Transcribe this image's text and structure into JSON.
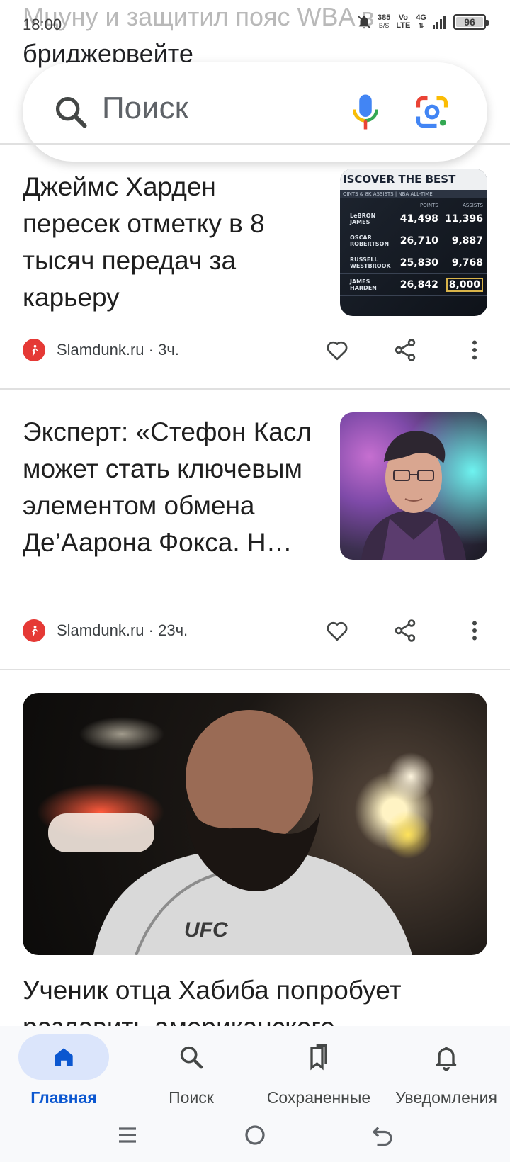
{
  "status_bar": {
    "time": "18:00",
    "net_speed_value": "385",
    "net_speed_unit": "B/S",
    "volte": "Vo",
    "lte": "LTE",
    "network": "4G",
    "battery": "96"
  },
  "previous_article": {
    "line1_start": "Мцуну и защитил пояс W",
    "line1_end": "BA в",
    "line2": "бриджервейте"
  },
  "search": {
    "placeholder": "Поиск"
  },
  "articles": [
    {
      "title": "Джеймс Харден пересек отметку в 8 тысяч передач за карьеру",
      "source": "Slamdunk.ru",
      "time": "3ч.",
      "thumbnail": {
        "header": "ISCOVER THE BEST",
        "subheader": "OINTS & 8K ASSISTS | NBA ALL-TIME",
        "col_points": "POINTS",
        "col_assists": "ASSISTS",
        "rows": [
          {
            "name_first": "LeBRON",
            "name_last": "JAMES",
            "points": "41,498",
            "assists": "11,396"
          },
          {
            "name_first": "OSCAR",
            "name_last": "ROBERTSON",
            "points": "26,710",
            "assists": "9,887"
          },
          {
            "name_first": "RUSSELL",
            "name_last": "WESTBROOK",
            "points": "25,830",
            "assists": "9,768"
          },
          {
            "name_first": "JAMES",
            "name_last": "HARDEN",
            "points": "26,842",
            "assists": "8,000"
          }
        ]
      }
    },
    {
      "title": "Эксперт: «Стефон Касл может стать ключевым элементом обмена Де’Аарона Фокса. Н…",
      "source": "Slamdunk.ru",
      "time": "23ч."
    },
    {
      "title": "Ученик отца Хабиба попробует",
      "title_cut": "раздавить американского",
      "photo_text": "UFC"
    }
  ],
  "source_separator": "·",
  "bottom_nav": {
    "items": [
      {
        "label": "Главная",
        "icon": "home-icon",
        "active": true
      },
      {
        "label": "Поиск",
        "icon": "search-icon",
        "active": false
      },
      {
        "label": "Сохраненные",
        "icon": "bookmarks-icon",
        "active": false
      },
      {
        "label": "Уведомления",
        "icon": "bell-icon",
        "active": false
      }
    ]
  },
  "colors": {
    "accent": "#0b57d0",
    "active_pill": "#dbe5fb",
    "source_logo": "#e53935"
  }
}
